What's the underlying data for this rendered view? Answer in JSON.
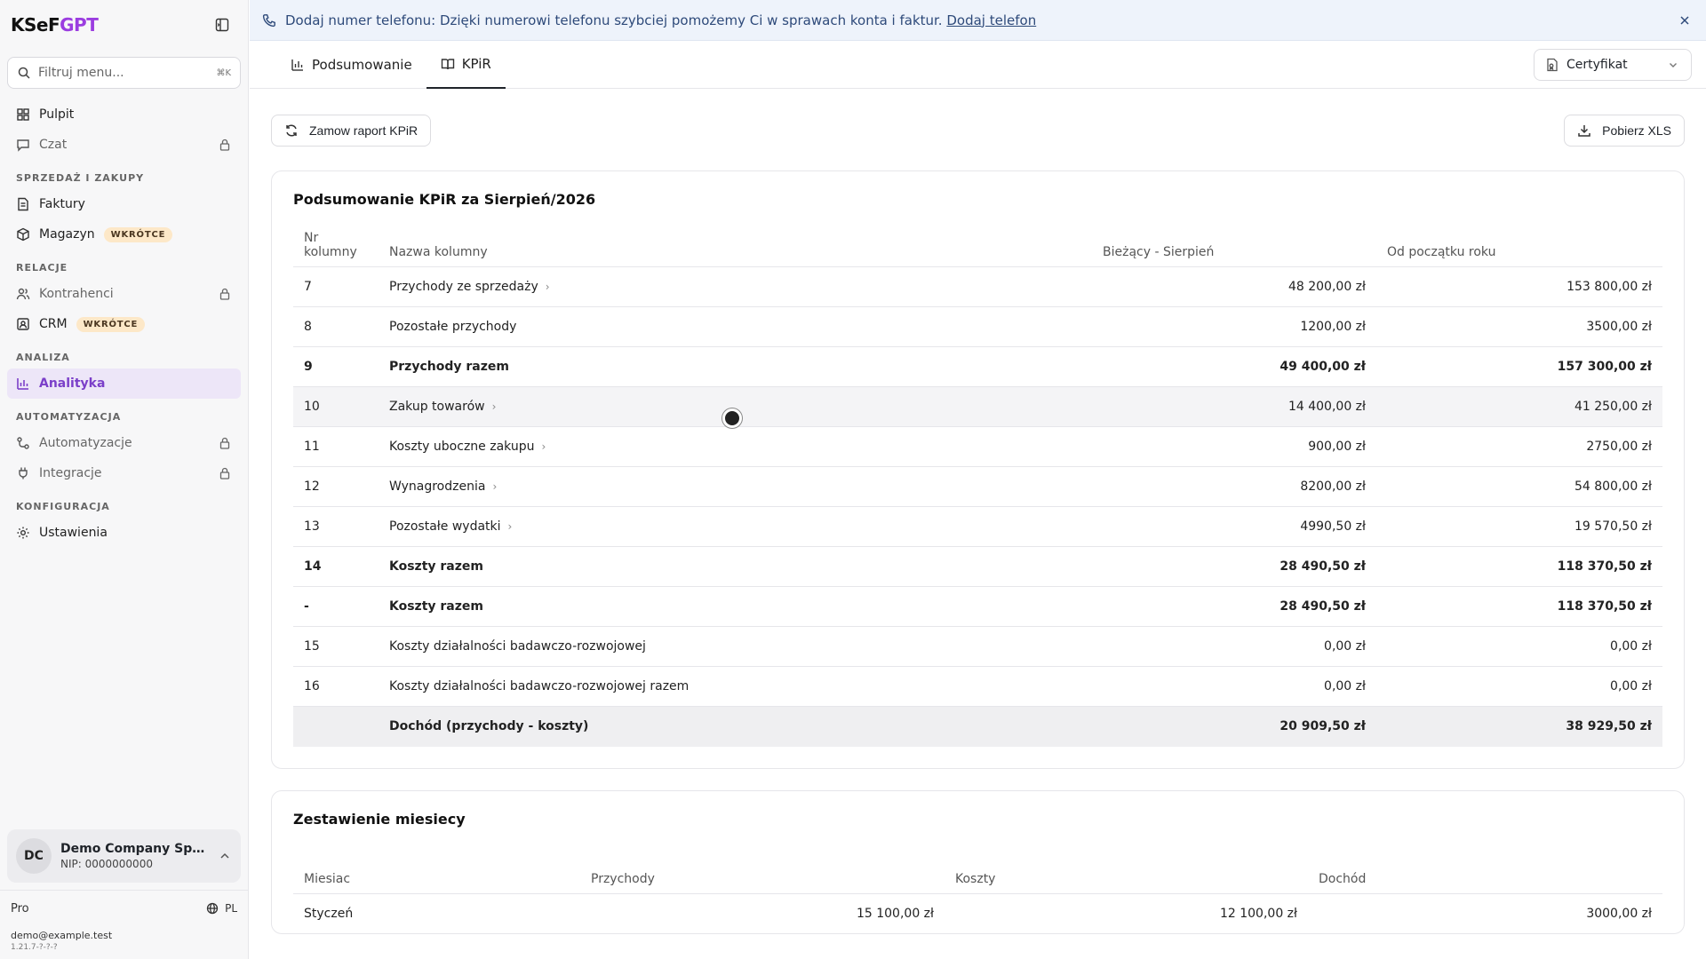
{
  "app": {
    "logo_main": "KSeF",
    "logo_accent": "GPT"
  },
  "sidebar": {
    "search_placeholder": "Filtruj menu...",
    "search_shortcut": "⌘K",
    "top_items": [
      {
        "label": "Pulpit",
        "icon": "dashboard-icon",
        "locked": false
      },
      {
        "label": "Czat",
        "icon": "chat-icon",
        "locked": true
      }
    ],
    "sections": [
      {
        "title": "SPRZEDAŻ I ZAKUPY",
        "items": [
          {
            "label": "Faktury",
            "icon": "document-icon"
          },
          {
            "label": "Magazyn",
            "icon": "box-icon",
            "badge": "WKRÓTCE"
          }
        ]
      },
      {
        "title": "RELACJE",
        "items": [
          {
            "label": "Kontrahenci",
            "icon": "users-icon",
            "locked": true
          },
          {
            "label": "CRM",
            "icon": "contact-icon",
            "badge": "WKRÓTCE"
          }
        ]
      },
      {
        "title": "ANALIZA",
        "items": [
          {
            "label": "Analityka",
            "icon": "bar-chart-icon",
            "active": true
          }
        ]
      },
      {
        "title": "AUTOMATYZACJA",
        "items": [
          {
            "label": "Automatyzacje",
            "icon": "workflow-icon",
            "locked": true
          },
          {
            "label": "Integracje",
            "icon": "plug-icon",
            "locked": true
          }
        ]
      },
      {
        "title": "KONFIGURACJA",
        "items": [
          {
            "label": "Ustawienia",
            "icon": "gear-icon"
          }
        ]
      }
    ],
    "company": {
      "initials": "DC",
      "name": "Demo Company Sp. ...",
      "nip": "NIP: 0000000000"
    },
    "plan": "Pro",
    "language": "PL",
    "email": "demo@example.test",
    "version": "1.21.7-?-?-?"
  },
  "banner": {
    "text": "Dodaj numer telefonu: Dzięki numerowi telefonu szybciej pomożemy Ci w sprawach konta i faktur.",
    "link": "Dodaj telefon"
  },
  "tabs": [
    {
      "label": "Podsumowanie",
      "icon": "bar-chart-icon",
      "active": false
    },
    {
      "label": "KPiR",
      "icon": "book-icon",
      "active": true
    }
  ],
  "certificate_select": {
    "label": "Certyfikat"
  },
  "actions": {
    "order_report": "Zamow raport KPiR",
    "download_xls": "Pobierz XLS"
  },
  "summary": {
    "title": "Podsumowanie KPiR za Sierpień/2026",
    "headers": {
      "nr_line1": "Nr",
      "nr_line2": "kolumny",
      "name": "Nazwa kolumny",
      "current": "Bieżący - Sierpień",
      "ytd": "Od początku roku"
    },
    "rows": [
      {
        "nr": "7",
        "name": "Przychody ze sprzedaży",
        "current": "48 200,00 zł",
        "ytd": "153 800,00 zł",
        "expandable": true,
        "style": "normal"
      },
      {
        "nr": "8",
        "name": "Pozostałe przychody",
        "current": "1200,00 zł",
        "ytd": "3500,00 zł",
        "expandable": false,
        "style": "normal"
      },
      {
        "nr": "9",
        "name": "Przychody razem",
        "current": "49 400,00 zł",
        "ytd": "157 300,00 zł",
        "expandable": false,
        "style": "bold"
      },
      {
        "nr": "10",
        "name": "Zakup towarów",
        "current": "14 400,00 zł",
        "ytd": "41 250,00 zł",
        "expandable": true,
        "style": "hover"
      },
      {
        "nr": "11",
        "name": "Koszty uboczne zakupu",
        "current": "900,00 zł",
        "ytd": "2750,00 zł",
        "expandable": true,
        "style": "normal"
      },
      {
        "nr": "12",
        "name": "Wynagrodzenia",
        "current": "8200,00 zł",
        "ytd": "54 800,00 zł",
        "expandable": true,
        "style": "normal"
      },
      {
        "nr": "13",
        "name": "Pozostałe wydatki",
        "current": "4990,50 zł",
        "ytd": "19 570,50 zł",
        "expandable": true,
        "style": "normal"
      },
      {
        "nr": "14",
        "name": "Koszty razem",
        "current": "28 490,50 zł",
        "ytd": "118 370,50 zł",
        "expandable": false,
        "style": "bold"
      },
      {
        "nr": "-",
        "name": "Koszty razem",
        "current": "28 490,50 zł",
        "ytd": "118 370,50 zł",
        "expandable": false,
        "style": "bold"
      },
      {
        "nr": "15",
        "name": "Koszty działalności badawczo-rozwojowej",
        "current": "0,00 zł",
        "ytd": "0,00 zł",
        "expandable": false,
        "style": "normal"
      },
      {
        "nr": "16",
        "name": "Koszty działalności badawczo-rozwojowej razem",
        "current": "0,00 zł",
        "ytd": "0,00 zł",
        "expandable": false,
        "style": "normal"
      },
      {
        "nr": "",
        "name": "Dochód (przychody - koszty)",
        "current": "20 909,50 zł",
        "ytd": "38 929,50 zł",
        "expandable": false,
        "style": "total"
      }
    ]
  },
  "months": {
    "title": "Zestawienie miesiecy",
    "headers": {
      "month": "Miesiac",
      "income": "Przychody",
      "costs": "Koszty",
      "profit": "Dochód"
    },
    "rows": [
      {
        "month": "Styczeń",
        "income": "15 100,00 zł",
        "costs": "12 100,00 zł",
        "profit": "3000,00 zł"
      }
    ]
  }
}
